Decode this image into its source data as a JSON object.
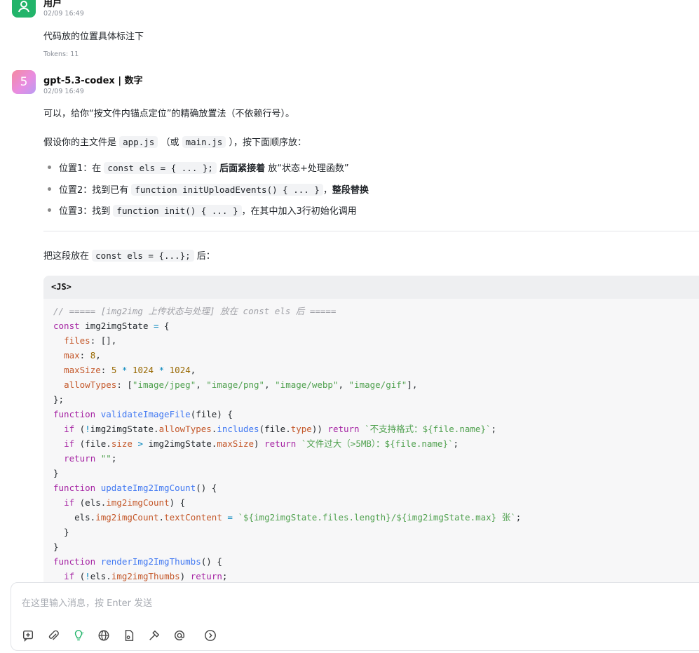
{
  "user_message": {
    "name": "用户",
    "time": "02/09 16:49",
    "text": "代码放的位置具体标注下",
    "tokens": "Tokens: 11"
  },
  "bot_message": {
    "avatar_label": "5",
    "name": "gpt-5.3-codex | 数字",
    "time": "02/09 16:49",
    "intro": "可以，给你“按文件内锚点定位”的精确放置法（不依赖行号）。",
    "p2_a": "假设你的主文件是",
    "p2_code1": "app.js",
    "p2_b": "（或",
    "p2_code2": "main.js",
    "p2_c": "），按下面顺序放：",
    "bullets": [
      {
        "a": "位置1：在",
        "code": "const els = { ... };",
        "bold": "后面紧接着",
        "b": "放“状态+处理函数”"
      },
      {
        "a": "位置2：找到已有",
        "code": "function initUploadEvents() { ... }",
        "bold": "整段替换",
        "b": "，"
      },
      {
        "a": "位置3：找到",
        "code": "function init() { ... }",
        "b": "，在其中加入3行初始化调用"
      }
    ],
    "p3_a": "把这段放在",
    "p3_code": "const els = {...};",
    "p3_b": "后："
  },
  "code_block": {
    "lang": "<JS>",
    "lines": [
      "// ===== [img2img 上传状态与处理] 放在 const els 后 =====",
      "const img2imgState = {",
      "  files: [],",
      "  max: 8,",
      "  maxSize: 5 * 1024 * 1024,",
      "  allowTypes: [\"image/jpeg\", \"image/png\", \"image/webp\", \"image/gif\"],",
      "};",
      "function validateImageFile(file) {",
      "  if (!img2imgState.allowTypes.includes(file.type)) return `不支持格式：${file.name}`;",
      "  if (file.size > img2imgState.maxSize) return `文件过大（>5MB）：${file.name}`;",
      "  return \"\";",
      "}",
      "function updateImg2ImgCount() {",
      "  if (els.img2imgCount) {",
      "    els.img2imgCount.textContent = `${img2imgState.files.length}/${img2imgState.max} 张`;",
      "  }",
      "}",
      "function renderImg2ImgThumbs() {",
      "  if (!els.img2imgThumbs) return;"
    ]
  },
  "input": {
    "placeholder": "在这里输入消息，按 Enter 发送"
  },
  "toolbar_icons": [
    "new-chat-icon",
    "attach-icon",
    "idea-icon",
    "globe-icon",
    "file-icon",
    "tools-icon",
    "mention-icon",
    "send-icon"
  ],
  "colors": {
    "user_avatar": "#22b46a",
    "comment": "#a0a1a7",
    "keyword": "#a626a4",
    "function": "#4078f2",
    "string": "#50a14f"
  }
}
